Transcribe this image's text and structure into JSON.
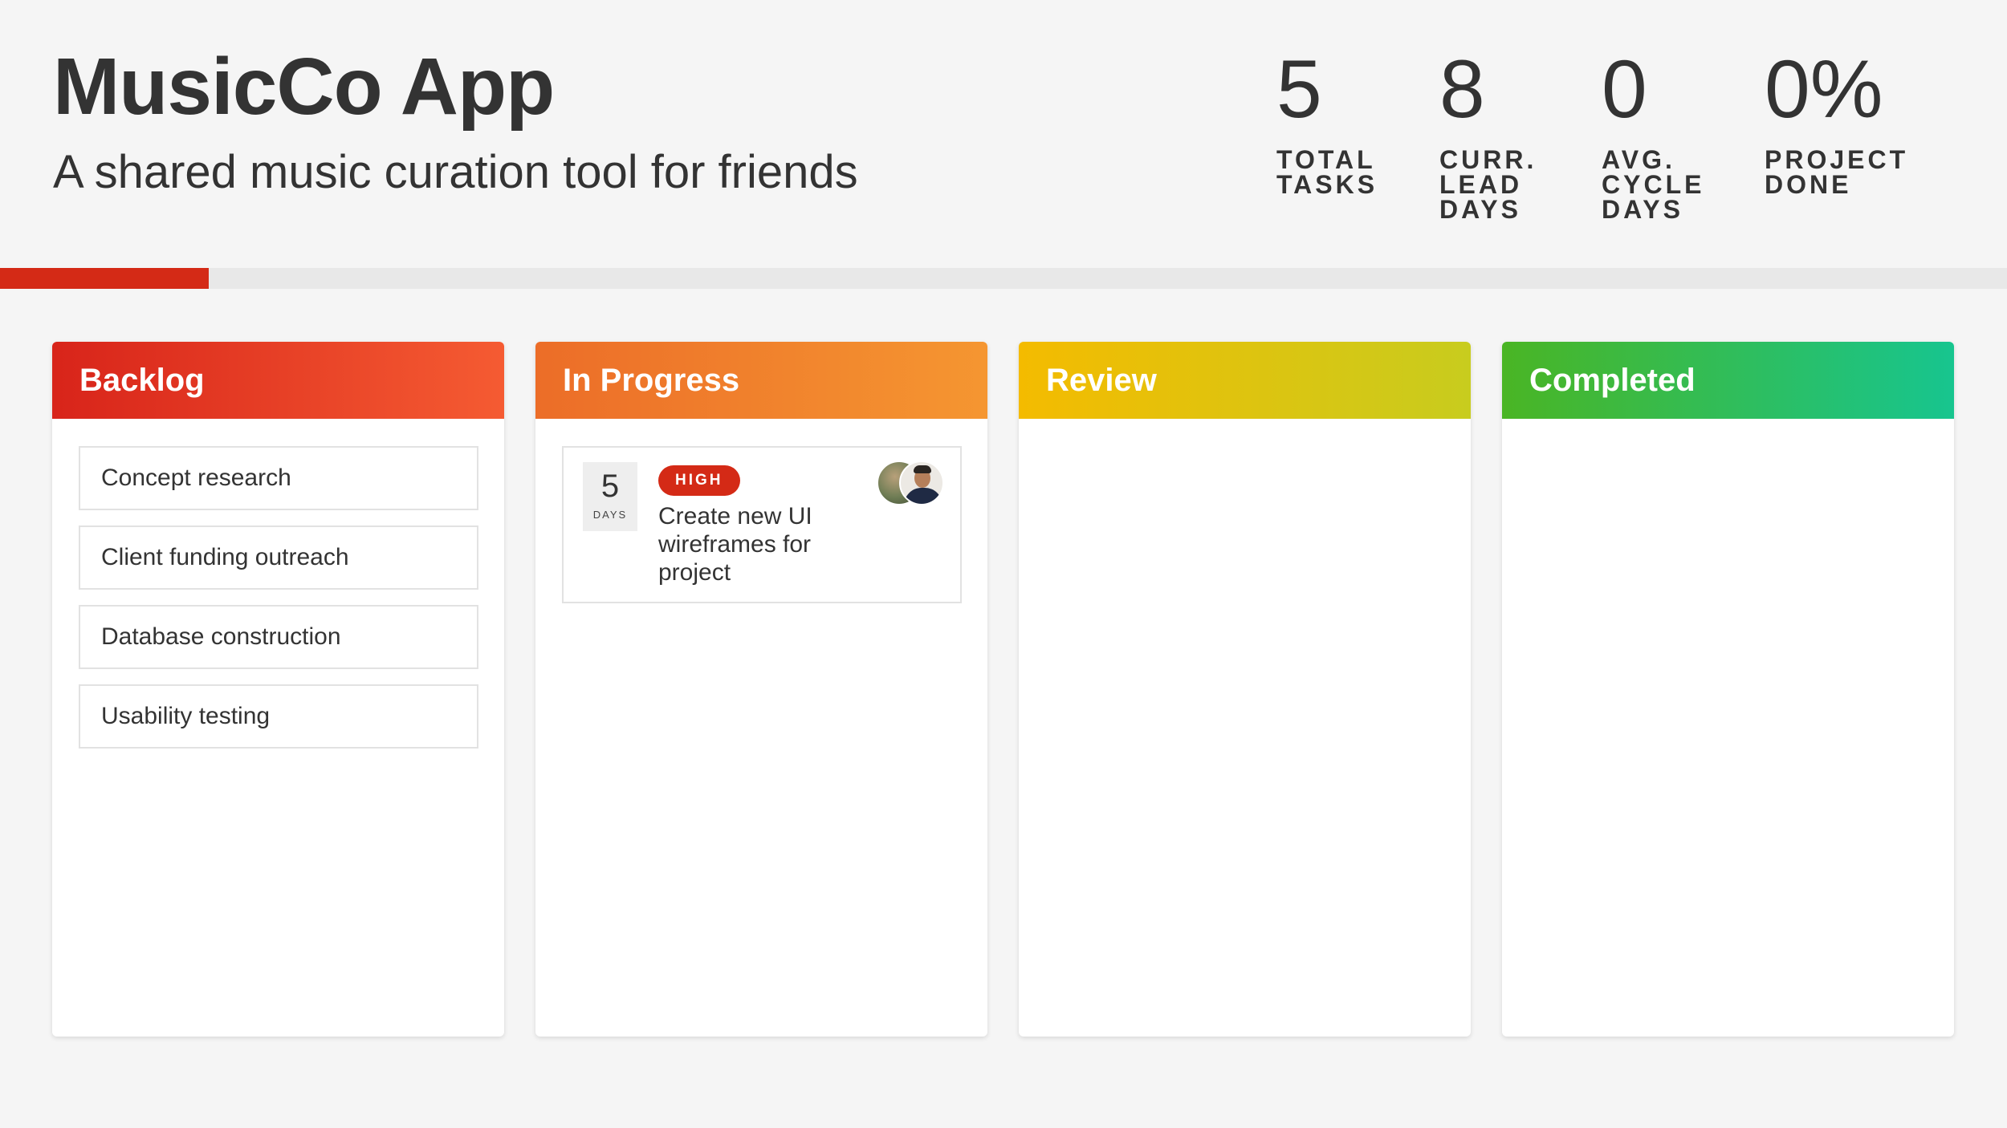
{
  "app": {
    "title": "MusicCo App",
    "subtitle": "A shared music curation tool for friends"
  },
  "stats": [
    {
      "value": "5",
      "label": "TOTAL TASKS"
    },
    {
      "value": "8",
      "label": "CURR. LEAD DAYS"
    },
    {
      "value": "0",
      "label": "AVG. CYCLE DAYS"
    },
    {
      "value": "0%",
      "label": "PROJECT DONE"
    }
  ],
  "progress": {
    "fraction": 0.104,
    "color": "#d42a16"
  },
  "columns": {
    "backlog": {
      "title": "Backlog",
      "tasks": [
        "Concept research",
        "Client funding outreach",
        "Database construction",
        "Usability testing"
      ]
    },
    "in_progress": {
      "title": "In Progress",
      "card": {
        "days_value": "5",
        "days_label": "DAYS",
        "priority": "HIGH",
        "title": "Create new UI wireframes for project",
        "avatars": [
          "avatar-user-1",
          "avatar-user-2"
        ]
      }
    },
    "review": {
      "title": "Review"
    },
    "completed": {
      "title": "Completed"
    }
  },
  "colors": {
    "backlog": [
      "#d8241a",
      "#f55b32"
    ],
    "in_progress": [
      "#ec6d28",
      "#f59631"
    ],
    "review": [
      "#f4bb00",
      "#c8cc1e"
    ],
    "completed": [
      "#4ab524",
      "#17c58f"
    ],
    "priority_high": "#d42a16"
  }
}
